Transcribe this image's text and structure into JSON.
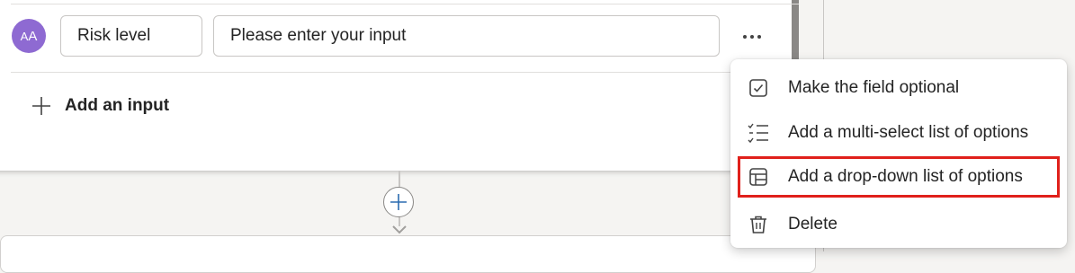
{
  "input_row": {
    "avatar_text_small": "A",
    "avatar_text_big": "A",
    "name_value": "Risk level",
    "value_placeholder": "Please enter your input"
  },
  "add_input_label": "Add an input",
  "menu": {
    "items": [
      {
        "label": "Make the field optional",
        "icon": "checkbox-icon"
      },
      {
        "label": "Add a multi-select list of options",
        "icon": "checklist-icon"
      },
      {
        "label": "Add a drop-down list of options",
        "icon": "table-dropdown-icon",
        "highlighted": true
      },
      {
        "label": "Delete",
        "icon": "trash-icon"
      }
    ]
  },
  "colors": {
    "avatar": "#8e6ad2",
    "highlight_border": "#e0201b",
    "plus_icon": "#2b6cb0"
  }
}
